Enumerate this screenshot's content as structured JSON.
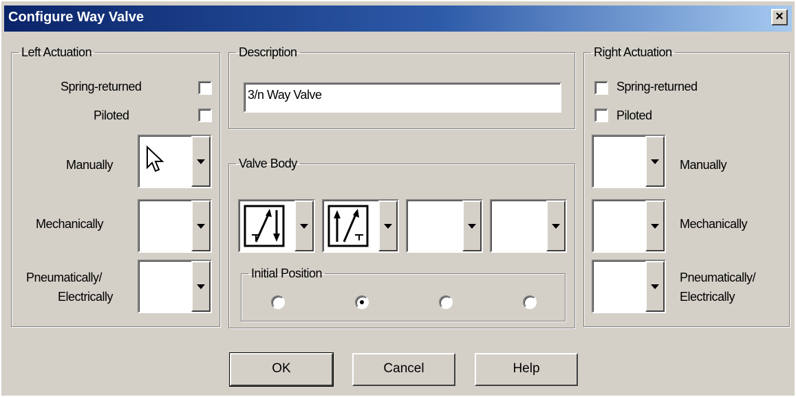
{
  "window": {
    "title": "Configure Way Valve",
    "close_label": "×"
  },
  "left_actuation": {
    "legend": "Left Actuation",
    "spring_returned": "Spring-returned",
    "piloted": "Piloted",
    "manually": "Manually",
    "mechanically": "Mechanically",
    "pneumatically_line1": "Pneumatically/",
    "pneumatically_line2": "Electrically"
  },
  "description": {
    "legend": "Description",
    "value": "3/n Way Valve"
  },
  "valve_body": {
    "legend": "Valve Body",
    "initial_position": {
      "legend": "Initial Position",
      "selected_index": 1
    }
  },
  "right_actuation": {
    "legend": "Right Actuation",
    "spring_returned": "Spring-returned",
    "piloted": "Piloted",
    "manually": "Manually",
    "mechanically": "Mechanically",
    "pneumatically_line1": "Pneumatically/",
    "pneumatically_line2": "Electrically"
  },
  "buttons": {
    "ok": "OK",
    "cancel": "Cancel",
    "help": "Help"
  },
  "icons": {
    "close": "close-icon",
    "cursor": "mouse-pointer-icon",
    "dropdown": "chevron-down-icon"
  },
  "colors": {
    "titlebar_start": "#0a246a",
    "titlebar_end": "#a6caf0",
    "dialog_bg": "#d4d0c8"
  }
}
